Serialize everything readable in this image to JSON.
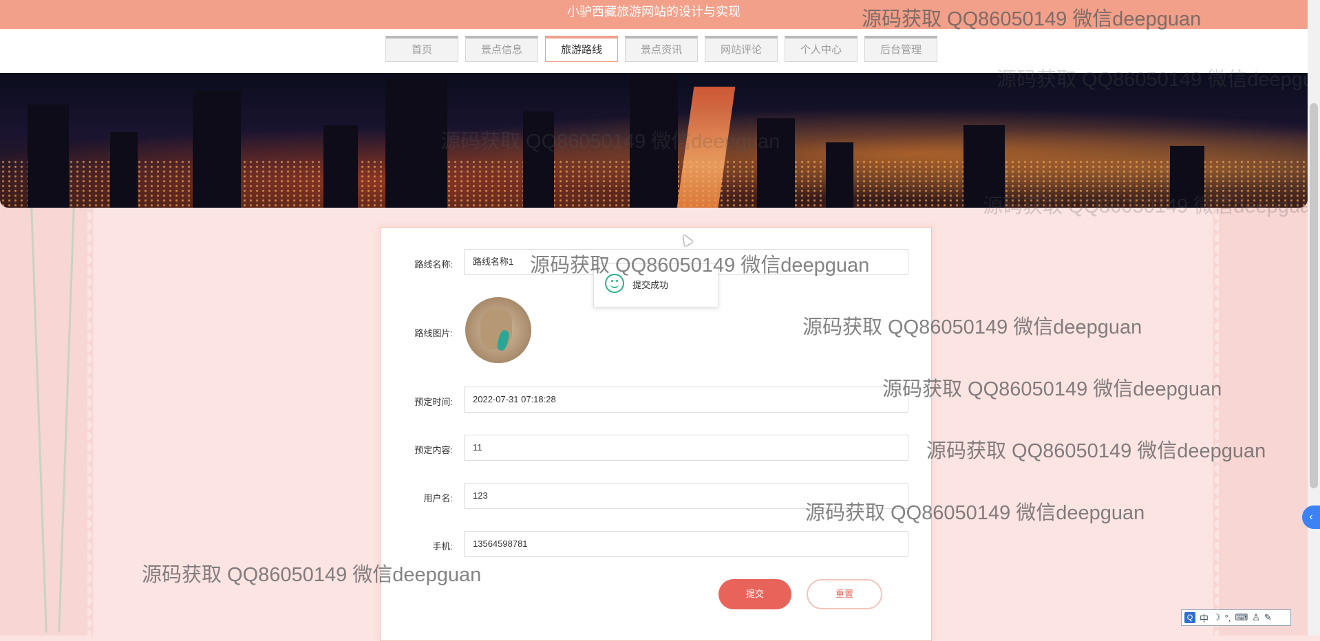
{
  "header": {
    "site_title": "小驴西藏旅游网站的设计与实现"
  },
  "nav": {
    "items": [
      {
        "label": "首页"
      },
      {
        "label": "景点信息"
      },
      {
        "label": "旅游路线",
        "active": true
      },
      {
        "label": "景点资讯"
      },
      {
        "label": "网站评论"
      },
      {
        "label": "个人中心"
      },
      {
        "label": "后台管理"
      }
    ]
  },
  "form": {
    "route_name": {
      "label": "路线名称:",
      "value": "路线名称1"
    },
    "route_image": {
      "label": "路线图片:"
    },
    "booking_time": {
      "label": "预定时间:",
      "value": "2022-07-31 07:18:28"
    },
    "booking_content": {
      "label": "预定内容:",
      "value": "11"
    },
    "username": {
      "label": "用户名:",
      "value": "123"
    },
    "phone": {
      "label": "手机:",
      "value": "13564598781"
    },
    "submit_label": "提交",
    "reset_label": "重置"
  },
  "toast": {
    "message": "提交成功"
  },
  "watermark": {
    "text": "源码获取 QQ86050149 微信deepguan"
  },
  "ime": {
    "lang": "中",
    "q": "Q"
  },
  "colors": {
    "accent": "#f3a08a",
    "button": "#e8645a",
    "success": "#27b48a"
  }
}
